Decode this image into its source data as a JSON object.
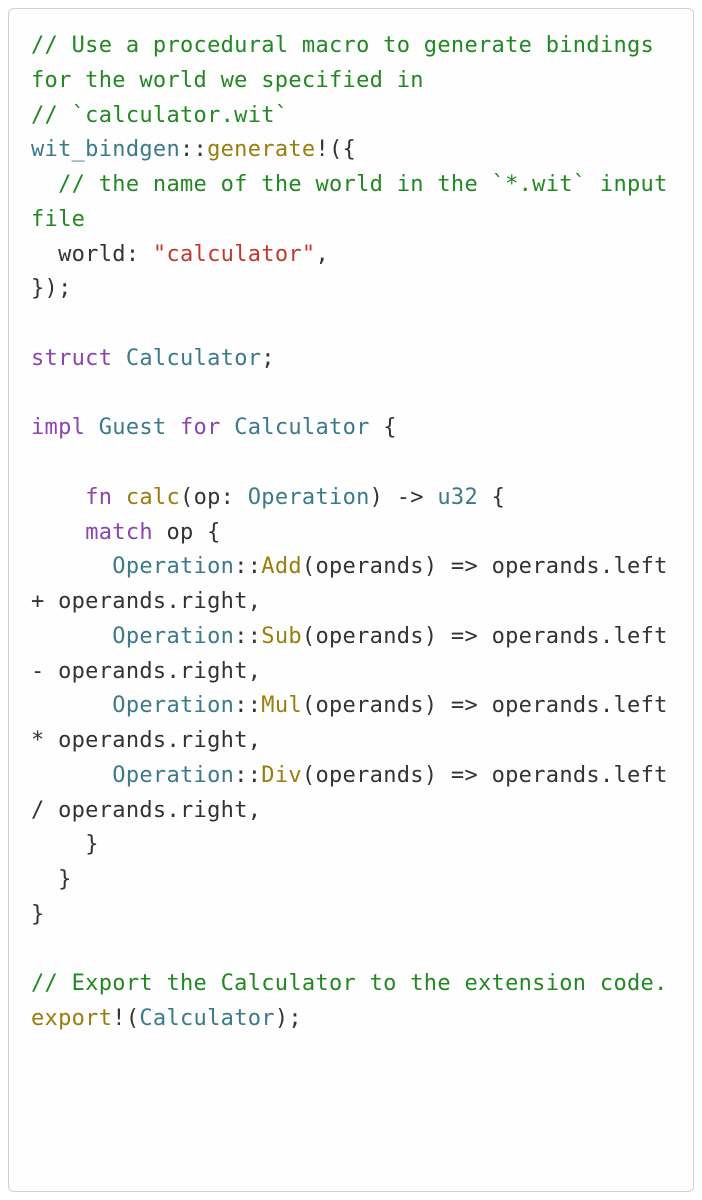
{
  "code": {
    "comment1": "// Use a procedural macro to generate bindings for the world we specified in",
    "comment2": "// `calculator.wit`",
    "ns1": "wit_bindgen",
    "dcolon": "::",
    "macro1": "generate",
    "bang_open": "!({",
    "comment3": "  // the name of the world in the `*.wit` input file",
    "world_indent": "  ",
    "world_key": "world",
    "colon_sp": ": ",
    "world_val": "\"calculator\"",
    "comma": ",",
    "close_macro": "});",
    "blank": "",
    "struct_kw": "struct",
    "sp": " ",
    "calc_type": "Calculator",
    "semi": ";",
    "impl_kw": "impl",
    "guest_type": "Guest",
    "for_kw": "for",
    "open_brace_sp": " {",
    "fn_indent": "    ",
    "fn_kw": "fn",
    "fn_name": "calc",
    "paren_open": "(",
    "param_name": "op",
    "op_type": "Operation",
    "paren_close_arrow": ") -> ",
    "ret_type": "u32",
    "match_indent": "    ",
    "match_kw": "match",
    "match_var": "op",
    "arm_indent": "      ",
    "op_enum": "Operation",
    "variant_add": "Add",
    "variant_sub": "Sub",
    "variant_mul": "Mul",
    "variant_div": "Div",
    "operands": "operands",
    "arrow": " => ",
    "opera_wrap": "opera",
    "nds": "nds",
    "dot": ".",
    "left": "left",
    "right": "right",
    "plus": " + ",
    "minus": " - ",
    "star": " * ",
    "slash": " / ",
    "close4": "    }",
    "close2": "  }",
    "close0": "}",
    "comment4": "// Export the Calculator to the extension code.",
    "export_macro": "export",
    "paren_close_semi": ");"
  }
}
